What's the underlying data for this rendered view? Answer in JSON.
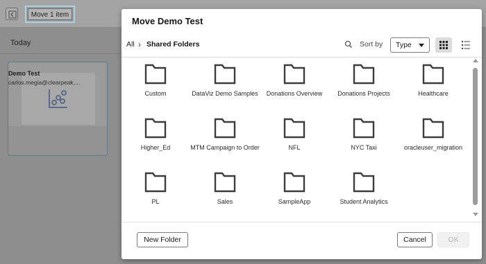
{
  "background": {
    "move_button_label": "Move 1 item",
    "section_title": "Today",
    "card": {
      "title": "Demo Test",
      "subtitle": "carlos.megia@clearpeak...."
    }
  },
  "dialog": {
    "title": "Move Demo Test",
    "breadcrumb": {
      "root": "All",
      "separator": "›",
      "current": "Shared Folders"
    },
    "sort": {
      "label": "Sort by",
      "selected": "Type"
    },
    "view_modes": [
      "grid-view-icon",
      "list-view-icon"
    ],
    "active_view": "grid",
    "folders": [
      {
        "name": "Custom"
      },
      {
        "name": "DataViz Demo Samples"
      },
      {
        "name": "Donations Overview"
      },
      {
        "name": "Donations Projects"
      },
      {
        "name": "Healthcare"
      },
      {
        "name": "Higher_Ed"
      },
      {
        "name": "MTM Campaign to Order"
      },
      {
        "name": "NFL"
      },
      {
        "name": "NYC Taxi"
      },
      {
        "name": "oracleuser_migration"
      },
      {
        "name": "PL"
      },
      {
        "name": "Sales"
      },
      {
        "name": "SampleApp"
      },
      {
        "name": "Student Analytics"
      }
    ],
    "buttons": {
      "new_folder": "New Folder",
      "cancel": "Cancel",
      "ok": "OK"
    }
  },
  "colors": {
    "overlay": "#8f8f8f",
    "dialog_bg": "#ffffff",
    "highlight_border": "#a7d3e3",
    "folder_icon": "#3c3c3c",
    "disabled_text": "#b5b5b5"
  }
}
